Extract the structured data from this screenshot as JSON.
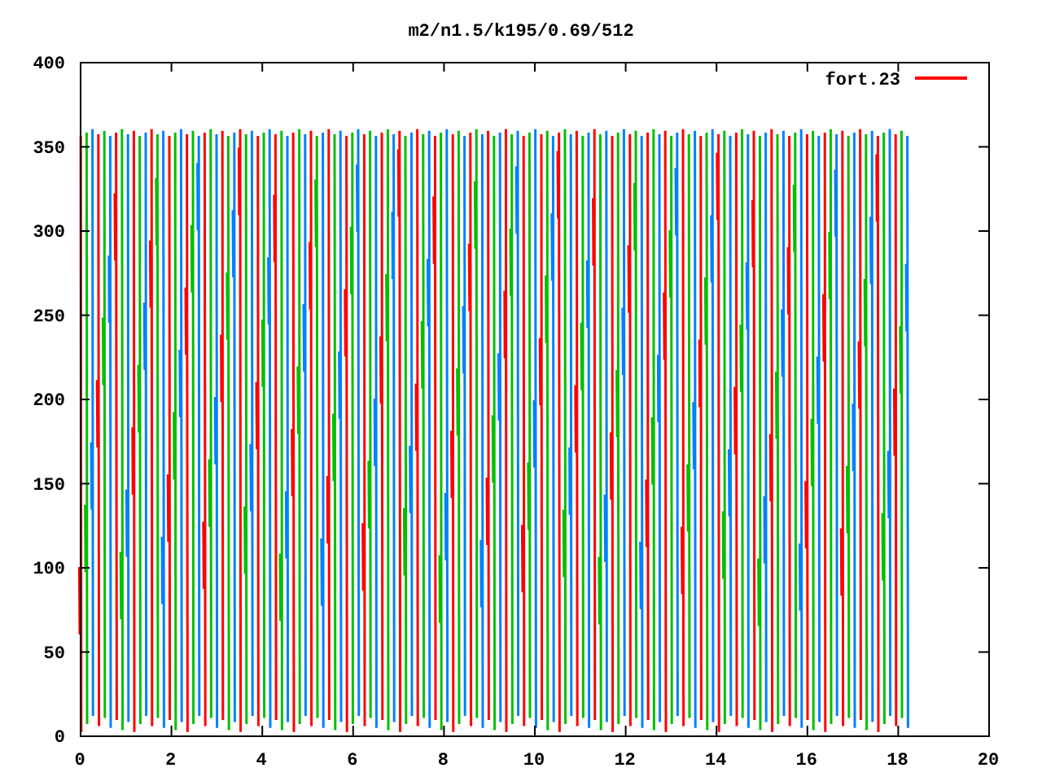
{
  "title": "m2/n1.5/k195/0.69/512",
  "y_ticks": [
    "400",
    "350",
    "300",
    "250",
    "200",
    "150",
    "100",
    "50",
    "0"
  ],
  "x_ticks": [
    "0",
    "2",
    "4",
    "6",
    "8",
    "10",
    "12",
    "14",
    "16",
    "18",
    "20"
  ],
  "legend": {
    "label": "fort.23",
    "color": "#ff0000"
  }
}
